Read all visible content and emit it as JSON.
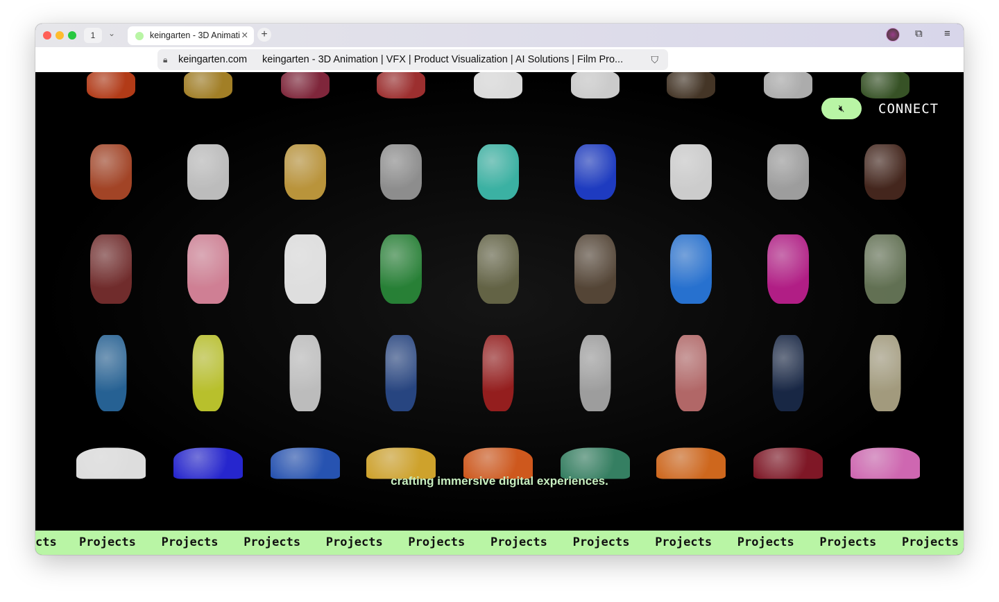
{
  "browser": {
    "tab_count": "1",
    "tab_title": "keingarten - 3D Animati",
    "url_domain": "keingarten.com",
    "page_title": "keingarten - 3D Animation | VFX | Product Visualization | AI Solutions | Film Pro..."
  },
  "page": {
    "connect_label": "CONNECT",
    "caption": "crafting immersive digital experiences.",
    "marquee_label": "Projects",
    "marquee_partial": "cts",
    "accent": "#b9f5a5"
  },
  "grid": [
    [
      {
        "icon": "beanie-icon",
        "color": "#c2401a"
      },
      {
        "icon": "helmet-icon",
        "color": "#b08a2a"
      },
      {
        "icon": "beanie-icon",
        "color": "#8a2a40"
      },
      {
        "icon": "football-helmet-icon",
        "color": "#aa3333"
      },
      {
        "icon": "cap-icon",
        "color": "#eeeeee"
      },
      {
        "icon": "helmet-icon",
        "color": "#dddddd"
      },
      {
        "icon": "bucket-hat-icon",
        "color": "#4a3a2a"
      },
      {
        "icon": "helmet-icon",
        "color": "#bbbbbb"
      },
      {
        "icon": "hood-icon",
        "color": "#3c5a2a"
      }
    ],
    [
      {
        "icon": "gloves-icon",
        "color": "#b04a2a"
      },
      {
        "icon": "trophy-icon",
        "color": "#cccccc"
      },
      {
        "icon": "chain-icon",
        "color": "#c9a040"
      },
      {
        "icon": "glasses-icon",
        "color": "#999999"
      },
      {
        "icon": "visor-icon",
        "color": "#40c0b0"
      },
      {
        "icon": "goggles-icon",
        "color": "#2040d0"
      },
      {
        "icon": "scarf-icon",
        "color": "#dddddd"
      },
      {
        "icon": "watch-icon",
        "color": "#aaaaaa"
      },
      {
        "icon": "bag-icon",
        "color": "#4a2a20"
      }
    ],
    [
      {
        "icon": "coat-icon",
        "color": "#7a3030"
      },
      {
        "icon": "jersey-icon",
        "color": "#e08aa0"
      },
      {
        "icon": "blazer-icon",
        "color": "#f0f0f0"
      },
      {
        "icon": "hoodie-icon",
        "color": "#2a8a3a"
      },
      {
        "icon": "shirt-icon",
        "color": "#6a6a4a"
      },
      {
        "icon": "jacket-icon",
        "color": "#5a4a3a"
      },
      {
        "icon": "shirt-icon",
        "color": "#2a7ae0"
      },
      {
        "icon": "puffer-icon",
        "color": "#c02090"
      },
      {
        "icon": "jacket-icon",
        "color": "#6a7a5a"
      }
    ],
    [
      {
        "icon": "pants-icon",
        "color": "#2a6aa0"
      },
      {
        "icon": "shorts-icon",
        "color": "#c8d030"
      },
      {
        "icon": "pants-icon",
        "color": "#cccccc"
      },
      {
        "icon": "jeans-icon",
        "color": "#2a4a8a"
      },
      {
        "icon": "pants-icon",
        "color": "#a02020"
      },
      {
        "icon": "pants-icon",
        "color": "#aaaaaa"
      },
      {
        "icon": "shorts-icon",
        "color": "#c07070"
      },
      {
        "icon": "jeans-icon",
        "color": "#1a2a4a"
      },
      {
        "icon": "pants-icon",
        "color": "#b0a888"
      }
    ],
    [
      {
        "icon": "sneaker-icon",
        "color": "#f0f0f0"
      },
      {
        "icon": "slide-icon",
        "color": "#2a2ae0"
      },
      {
        "icon": "sneaker-icon",
        "color": "#2a5ac0"
      },
      {
        "icon": "sneaker-icon",
        "color": "#e0b030"
      },
      {
        "icon": "sneaker-icon",
        "color": "#e06020"
      },
      {
        "icon": "sneaker-icon",
        "color": "#3a8a6a"
      },
      {
        "icon": "sneaker-icon",
        "color": "#e07020"
      },
      {
        "icon": "sneaker-icon",
        "color": "#8a1a2a"
      },
      {
        "icon": "slide-icon",
        "color": "#e070c0"
      }
    ]
  ]
}
